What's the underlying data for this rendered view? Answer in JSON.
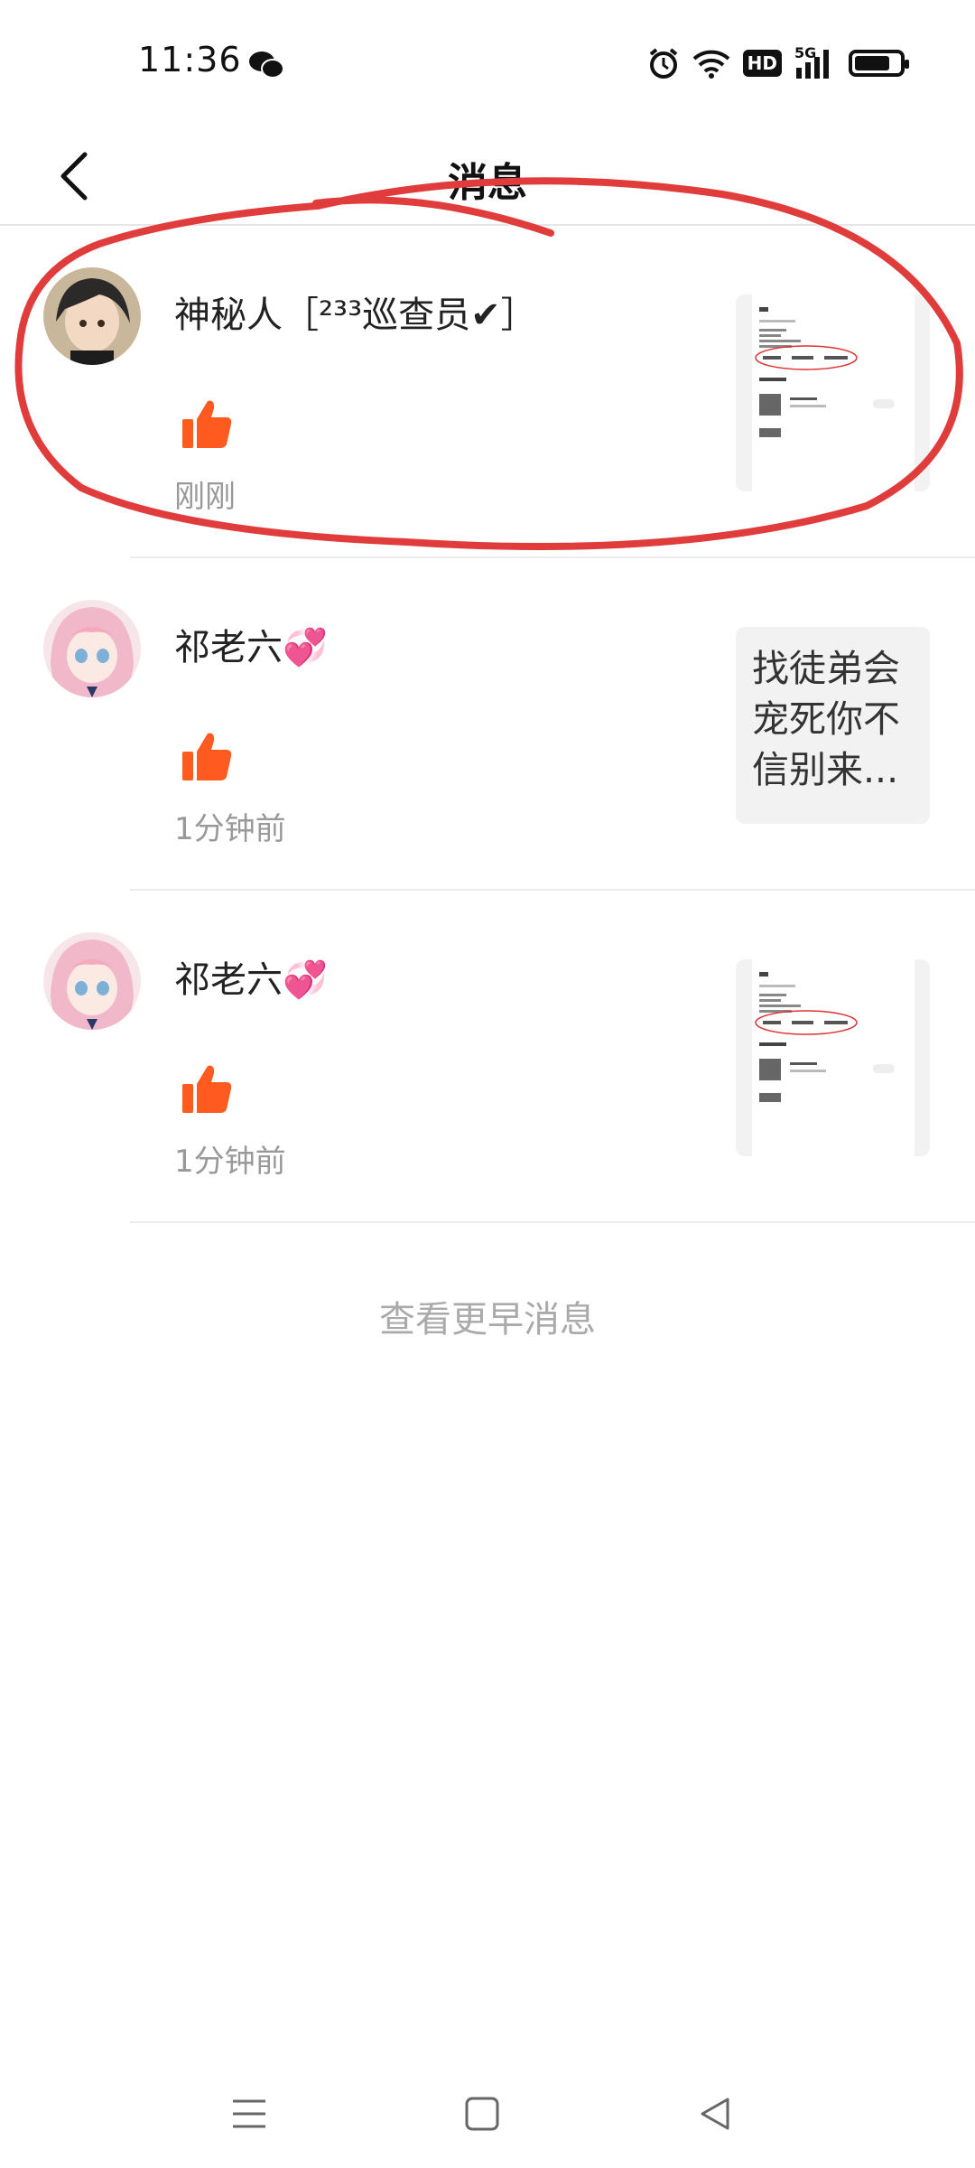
{
  "status_bar": {
    "time": "11:36",
    "network": "5G",
    "hd": "HD",
    "battery_level": 0.8
  },
  "header": {
    "title": "消息"
  },
  "messages": [
    {
      "name": "神秘人［²³³巡查员✔］",
      "action_icon": "thumbs-up-icon",
      "time": "刚刚",
      "preview_type": "screenshot"
    },
    {
      "name": "祁老六💞",
      "action_icon": "thumbs-up-icon",
      "time": "1分钟前",
      "preview_type": "text",
      "preview_text": "找徒弟会宠死你不信别来..."
    },
    {
      "name": "祁老六💞",
      "action_icon": "thumbs-up-icon",
      "time": "1分钟前",
      "preview_type": "screenshot"
    }
  ],
  "footer": {
    "earlier_label": "查看更早消息"
  },
  "colors": {
    "accent": "#ff5a1f",
    "annotation": "#e03c3c"
  }
}
